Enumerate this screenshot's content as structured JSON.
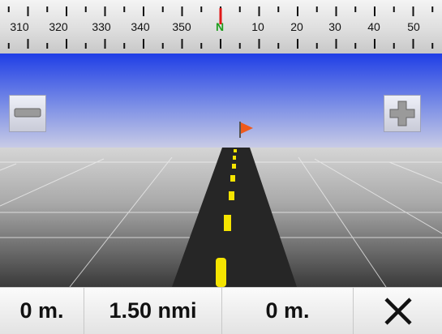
{
  "compass": {
    "labels": [
      "310",
      "320",
      "330",
      "340",
      "350",
      "N",
      "10",
      "20",
      "30",
      "40",
      "50"
    ],
    "north_color": "#1e9e1e"
  },
  "status": {
    "distance_left": "0 m.",
    "distance_total": "1.50 nmi",
    "distance_right": "0 m."
  },
  "icons": {
    "zoom_out": "minus-icon",
    "zoom_in": "plus-icon",
    "close": "close-icon",
    "destination": "flag-icon"
  },
  "colors": {
    "sky_top": "#1f3ee6",
    "sky_bottom": "#c8cbe6",
    "road": "#262626",
    "lane_marking": "#f5e400",
    "flag": "#ef5a1c"
  }
}
